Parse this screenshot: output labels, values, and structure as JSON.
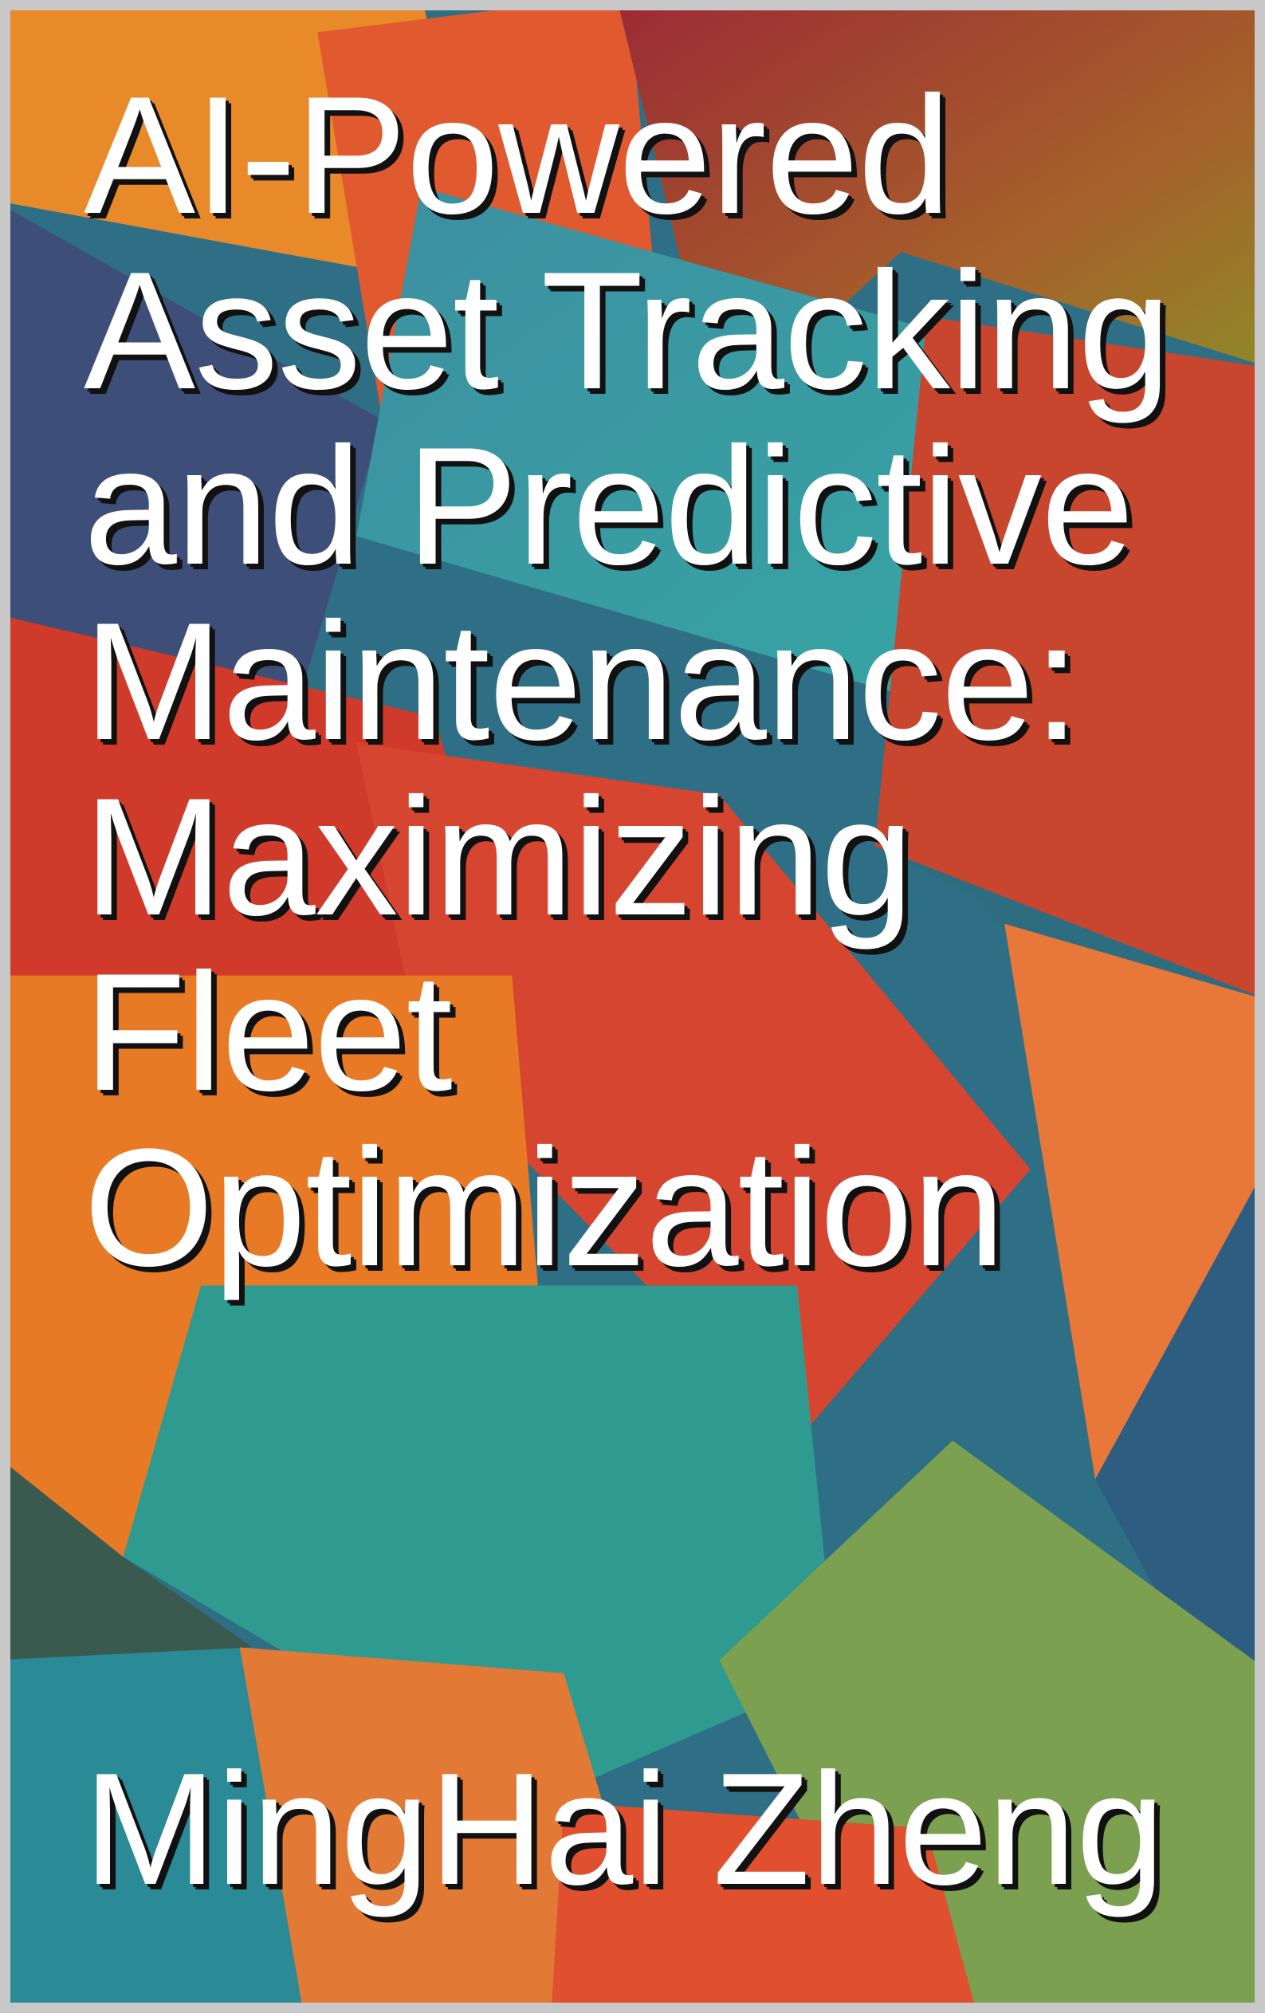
{
  "cover": {
    "title_lines": [
      "AI-Powered",
      "Asset Tracking",
      "and Predictive",
      "Maintenance:",
      "Maximizing",
      "Fleet",
      "Optimization"
    ],
    "author": "MingHai Zheng",
    "colors": {
      "border": "#c8c8c8",
      "text": "#ffffff",
      "text_shadow": "#111111",
      "palette": [
        "#e8892a",
        "#e0592f",
        "#b03a2e",
        "#3a9aa0",
        "#d03a2a",
        "#2f9a90",
        "#7aa050",
        "#3d4f78"
      ]
    }
  }
}
